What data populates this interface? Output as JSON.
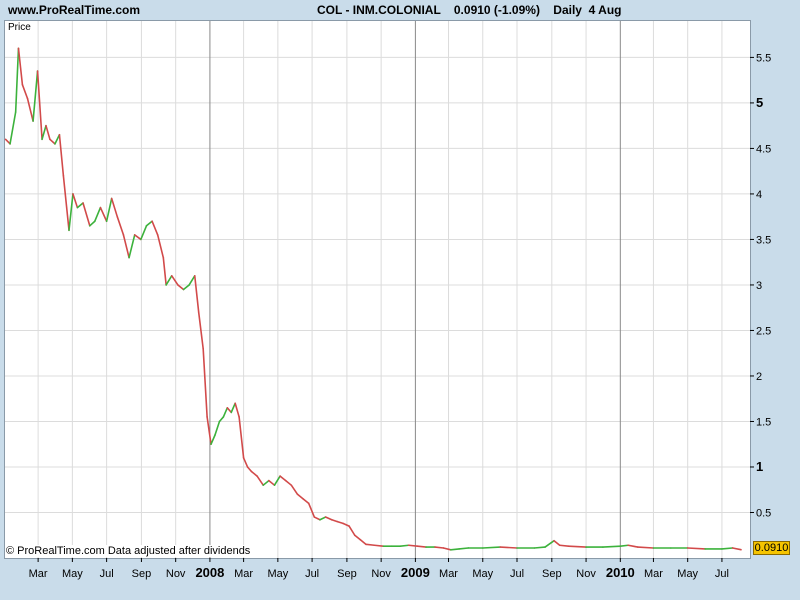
{
  "header": {
    "site": "www.ProRealTime.com",
    "ticker_line": "COL - INM.COLONIAL    0.0910 (-1.09%)    Daily  4 Aug"
  },
  "footer_note": "© ProRealTime.com  Data adjusted after dividends",
  "last_price_label": "0.0910",
  "colors": {
    "up": "#3cb23c",
    "down": "#d24a4a",
    "grid": "#dcdcdc",
    "year_line": "#8a8a8a",
    "price_tag": "#f5c400"
  },
  "chart_data": {
    "type": "line",
    "title": "COL - INM.COLONIAL",
    "ylabel": "Price",
    "ylim": [
      0,
      5.9
    ],
    "y_ticks": [
      {
        "value": 0.5,
        "label": "0.5",
        "major": false
      },
      {
        "value": 1,
        "label": "1",
        "major": true
      },
      {
        "value": 1.5,
        "label": "1.5",
        "major": false
      },
      {
        "value": 2,
        "label": "2",
        "major": false
      },
      {
        "value": 2.5,
        "label": "2.5",
        "major": false
      },
      {
        "value": 3,
        "label": "3",
        "major": false
      },
      {
        "value": 3.5,
        "label": "3.5",
        "major": false
      },
      {
        "value": 4,
        "label": "4",
        "major": false
      },
      {
        "value": 4.5,
        "label": "4.5",
        "major": false
      },
      {
        "value": 5,
        "label": "5",
        "major": true
      },
      {
        "value": 5.5,
        "label": "5.5",
        "major": false
      }
    ],
    "x_ticks": [
      {
        "date": "2007-03-01",
        "label": "Mar",
        "year": false
      },
      {
        "date": "2007-05-01",
        "label": "May",
        "year": false
      },
      {
        "date": "2007-07-01",
        "label": "Jul",
        "year": false
      },
      {
        "date": "2007-09-01",
        "label": "Sep",
        "year": false
      },
      {
        "date": "2007-11-01",
        "label": "Nov",
        "year": false
      },
      {
        "date": "2008-01-01",
        "label": "2008",
        "year": true
      },
      {
        "date": "2008-03-01",
        "label": "Mar",
        "year": false
      },
      {
        "date": "2008-05-01",
        "label": "May",
        "year": false
      },
      {
        "date": "2008-07-01",
        "label": "Jul",
        "year": false
      },
      {
        "date": "2008-09-01",
        "label": "Sep",
        "year": false
      },
      {
        "date": "2008-11-01",
        "label": "Nov",
        "year": false
      },
      {
        "date": "2009-01-01",
        "label": "2009",
        "year": true
      },
      {
        "date": "2009-03-01",
        "label": "Mar",
        "year": false
      },
      {
        "date": "2009-05-01",
        "label": "May",
        "year": false
      },
      {
        "date": "2009-07-01",
        "label": "Jul",
        "year": false
      },
      {
        "date": "2009-09-01",
        "label": "Sep",
        "year": false
      },
      {
        "date": "2009-11-01",
        "label": "Nov",
        "year": false
      },
      {
        "date": "2010-01-01",
        "label": "2010",
        "year": true
      },
      {
        "date": "2010-03-01",
        "label": "Mar",
        "year": false
      },
      {
        "date": "2010-05-01",
        "label": "May",
        "year": false
      },
      {
        "date": "2010-07-01",
        "label": "Jul",
        "year": false
      }
    ],
    "x_range": [
      "2007-01-01",
      "2010-08-20"
    ],
    "series": [
      {
        "points": [
          [
            "2007-01-02",
            4.6
          ],
          [
            "2007-01-10",
            4.55
          ],
          [
            "2007-01-20",
            4.9
          ],
          [
            "2007-01-25",
            5.6
          ],
          [
            "2007-02-01",
            5.2
          ],
          [
            "2007-02-10",
            5.05
          ],
          [
            "2007-02-20",
            4.8
          ],
          [
            "2007-02-28",
            5.35
          ],
          [
            "2007-03-08",
            4.6
          ],
          [
            "2007-03-15",
            4.75
          ],
          [
            "2007-03-22",
            4.6
          ],
          [
            "2007-03-31",
            4.55
          ],
          [
            "2007-04-08",
            4.65
          ],
          [
            "2007-04-15",
            4.2
          ],
          [
            "2007-04-25",
            3.6
          ],
          [
            "2007-05-02",
            4.0
          ],
          [
            "2007-05-10",
            3.85
          ],
          [
            "2007-05-20",
            3.9
          ],
          [
            "2007-06-01",
            3.65
          ],
          [
            "2007-06-10",
            3.7
          ],
          [
            "2007-06-20",
            3.85
          ],
          [
            "2007-07-01",
            3.7
          ],
          [
            "2007-07-10",
            3.95
          ],
          [
            "2007-07-20",
            3.75
          ],
          [
            "2007-07-31",
            3.55
          ],
          [
            "2007-08-10",
            3.3
          ],
          [
            "2007-08-20",
            3.55
          ],
          [
            "2007-08-31",
            3.5
          ],
          [
            "2007-09-10",
            3.65
          ],
          [
            "2007-09-20",
            3.7
          ],
          [
            "2007-09-30",
            3.55
          ],
          [
            "2007-10-10",
            3.3
          ],
          [
            "2007-10-15",
            3.0
          ],
          [
            "2007-10-25",
            3.1
          ],
          [
            "2007-11-05",
            3.0
          ],
          [
            "2007-11-15",
            2.95
          ],
          [
            "2007-11-25",
            3.0
          ],
          [
            "2007-12-05",
            3.1
          ],
          [
            "2007-12-12",
            2.7
          ],
          [
            "2007-12-20",
            2.3
          ],
          [
            "2007-12-27",
            1.55
          ],
          [
            "2008-01-03",
            1.25
          ],
          [
            "2008-01-10",
            1.35
          ],
          [
            "2008-01-18",
            1.5
          ],
          [
            "2008-01-25",
            1.55
          ],
          [
            "2008-02-01",
            1.65
          ],
          [
            "2008-02-08",
            1.6
          ],
          [
            "2008-02-15",
            1.7
          ],
          [
            "2008-02-22",
            1.55
          ],
          [
            "2008-03-01",
            1.1
          ],
          [
            "2008-03-08",
            1.0
          ],
          [
            "2008-03-15",
            0.95
          ],
          [
            "2008-03-25",
            0.9
          ],
          [
            "2008-04-05",
            0.8
          ],
          [
            "2008-04-15",
            0.85
          ],
          [
            "2008-04-25",
            0.8
          ],
          [
            "2008-05-05",
            0.9
          ],
          [
            "2008-05-15",
            0.85
          ],
          [
            "2008-05-25",
            0.8
          ],
          [
            "2008-06-05",
            0.7
          ],
          [
            "2008-06-15",
            0.65
          ],
          [
            "2008-06-25",
            0.6
          ],
          [
            "2008-07-05",
            0.45
          ],
          [
            "2008-07-15",
            0.42
          ],
          [
            "2008-07-25",
            0.45
          ],
          [
            "2008-08-05",
            0.42
          ],
          [
            "2008-08-15",
            0.4
          ],
          [
            "2008-08-25",
            0.38
          ],
          [
            "2008-09-05",
            0.35
          ],
          [
            "2008-09-15",
            0.25
          ],
          [
            "2008-09-25",
            0.2
          ],
          [
            "2008-10-05",
            0.15
          ],
          [
            "2008-10-20",
            0.14
          ],
          [
            "2008-11-05",
            0.13
          ],
          [
            "2008-11-20",
            0.13
          ],
          [
            "2008-12-05",
            0.13
          ],
          [
            "2008-12-20",
            0.14
          ],
          [
            "2009-01-05",
            0.13
          ],
          [
            "2009-01-20",
            0.12
          ],
          [
            "2009-02-05",
            0.12
          ],
          [
            "2009-02-20",
            0.11
          ],
          [
            "2009-03-05",
            0.09
          ],
          [
            "2009-03-20",
            0.1
          ],
          [
            "2009-04-05",
            0.11
          ],
          [
            "2009-05-01",
            0.11
          ],
          [
            "2009-06-01",
            0.12
          ],
          [
            "2009-07-01",
            0.11
          ],
          [
            "2009-08-01",
            0.11
          ],
          [
            "2009-08-20",
            0.12
          ],
          [
            "2009-09-05",
            0.19
          ],
          [
            "2009-09-15",
            0.14
          ],
          [
            "2009-10-01",
            0.13
          ],
          [
            "2009-11-01",
            0.12
          ],
          [
            "2009-12-01",
            0.12
          ],
          [
            "2010-01-01",
            0.13
          ],
          [
            "2010-01-15",
            0.14
          ],
          [
            "2010-02-01",
            0.12
          ],
          [
            "2010-03-01",
            0.11
          ],
          [
            "2010-04-01",
            0.11
          ],
          [
            "2010-05-01",
            0.11
          ],
          [
            "2010-06-01",
            0.1
          ],
          [
            "2010-07-01",
            0.1
          ],
          [
            "2010-07-20",
            0.11
          ],
          [
            "2010-08-04",
            0.091
          ]
        ]
      }
    ]
  }
}
